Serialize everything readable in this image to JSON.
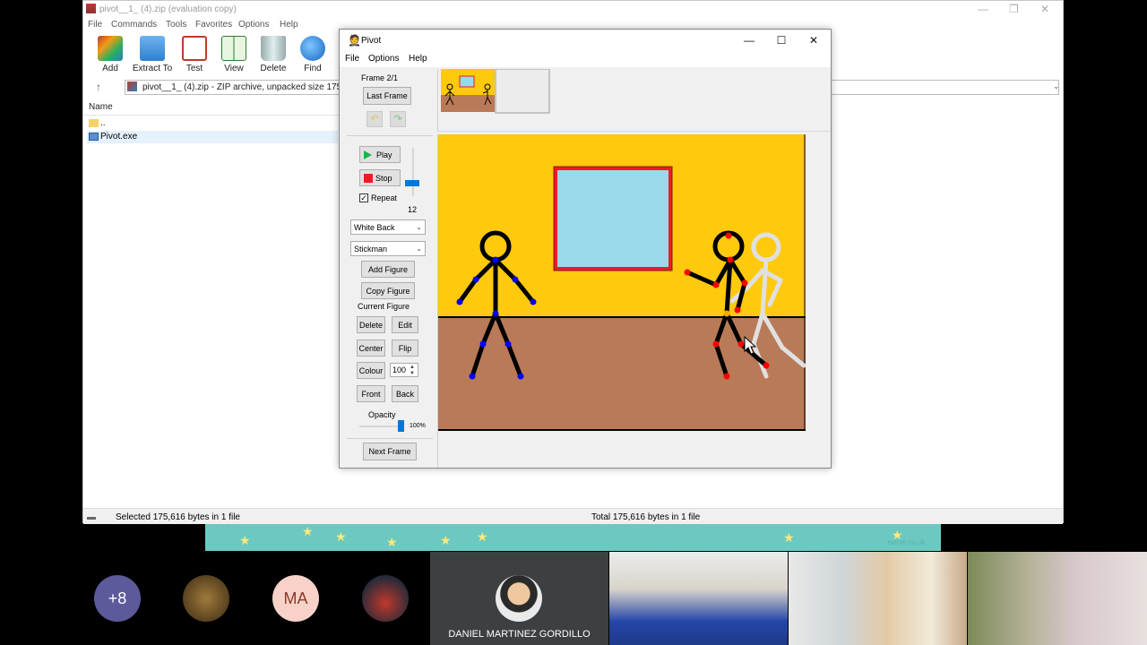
{
  "winrar": {
    "title": "pivot__1_ (4).zip (evaluation copy)",
    "menu": [
      "File",
      "Commands",
      "Tools",
      "Favorites",
      "Options",
      "Help"
    ],
    "toolbar": [
      "Add",
      "Extract To",
      "Test",
      "View",
      "Delete",
      "Find"
    ],
    "address": "pivot__1_ (4).zip - ZIP archive, unpacked size 175,616",
    "column_name": "Name",
    "rows": [
      "..",
      "Pivot.exe"
    ],
    "status_left": "Selected 175,616 bytes in 1 file",
    "status_right": "Total 175,616 bytes in 1 file"
  },
  "pivot": {
    "title": "Pivot",
    "menu": [
      "File",
      "Options",
      "Help"
    ],
    "frame_label": "Frame 2/1",
    "last_frame": "Last Frame",
    "play": "Play",
    "stop": "Stop",
    "repeat": "Repeat",
    "speed_value": "12",
    "background_select": "White Back",
    "figure_select": "Stickman",
    "add_figure": "Add Figure",
    "copy_figure": "Copy Figure",
    "current_figure": "Current Figure",
    "delete": "Delete",
    "edit": "Edit",
    "center": "Center",
    "flip": "Flip",
    "colour": "Colour",
    "colour_value": "100",
    "front": "Front",
    "back": "Back",
    "opacity": "Opacity",
    "opacity_value": "100%",
    "next_frame": "Next Frame",
    "watermark": "twinkl.co.uk"
  },
  "meet": {
    "more_count": "+8",
    "initials": "MA",
    "presenter_name": "DANIEL MARTINEZ GORDILLO"
  },
  "colors": {
    "wall": "#ffc90e",
    "floor": "#b97a57",
    "window_glass": "#99d9ea",
    "window_frame": "#ed1c24",
    "joint_blue": "#0000ff",
    "joint_red": "#ff0000",
    "banner": "#6cc9c1"
  }
}
